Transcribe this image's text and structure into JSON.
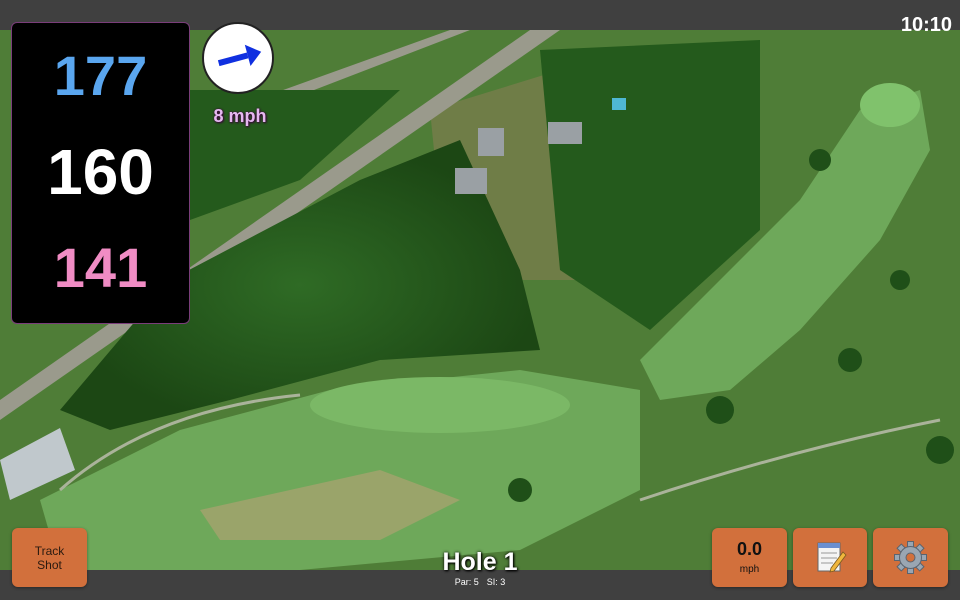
{
  "status": {
    "time": "10:10"
  },
  "distances": {
    "back": "177",
    "middle": "160",
    "front": "141"
  },
  "wind": {
    "speed_label": "8 mph",
    "icon": "wind-arrow-icon"
  },
  "buttons": {
    "track_shot": [
      "Track",
      "Shot"
    ],
    "speed_value": "0.0",
    "speed_unit": "mph",
    "notes_icon": "notepad-icon",
    "settings_icon": "gear-icon"
  },
  "hole": {
    "title": "Hole 1",
    "par": "Par: 5",
    "si": "SI: 3"
  },
  "colors": {
    "button": "#d2703c",
    "back_distance": "#5aa6ef",
    "front_distance": "#f08cc4",
    "wind_label": "#e5b8f0"
  }
}
